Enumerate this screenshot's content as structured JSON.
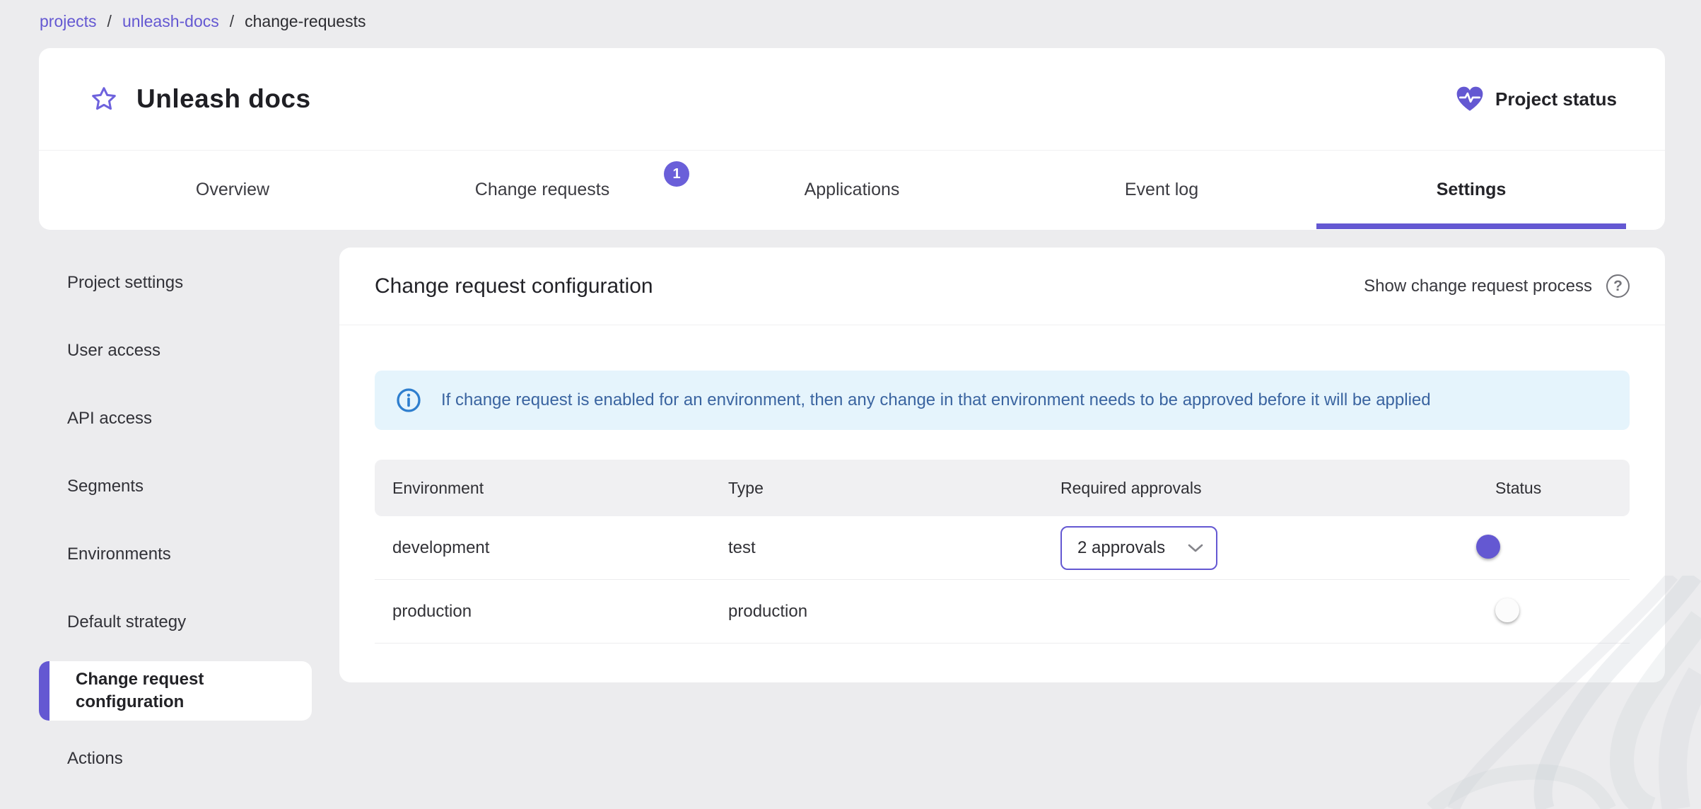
{
  "theme": {
    "primary": "#6458d2",
    "primary_light": "#aba3e8",
    "page_bg": "#ececee",
    "card_bg": "#ffffff",
    "alert_bg": "#e5f4fc",
    "alert_text": "#3a64a0",
    "alert_icon": "#2e7ece",
    "toggle_off": "#a5a5a5",
    "table_header_bg": "#f0f0f2"
  },
  "breadcrumb": {
    "separator": "/",
    "items": [
      {
        "label": "projects"
      },
      {
        "label": "unleash-docs"
      },
      {
        "label": "change-requests"
      }
    ]
  },
  "project_header": {
    "title": "Unleash docs",
    "status_label": "Project status"
  },
  "tabs": [
    {
      "label": "Overview"
    },
    {
      "label": "Change requests",
      "badge": "1"
    },
    {
      "label": "Applications"
    },
    {
      "label": "Event log"
    },
    {
      "label": "Settings",
      "active": true
    }
  ],
  "sidebar": {
    "items": [
      {
        "label": "Project settings"
      },
      {
        "label": "User access"
      },
      {
        "label": "API access"
      },
      {
        "label": "Segments"
      },
      {
        "label": "Environments"
      },
      {
        "label": "Default strategy"
      },
      {
        "label": "Change request configuration",
        "active": true
      },
      {
        "label": "Actions"
      }
    ]
  },
  "main": {
    "title": "Change request configuration",
    "help_link": "Show change request process",
    "help_glyph": "?",
    "alert": "If change request is enabled for an environment, then any change in that environment needs to be approved before it will be applied",
    "table": {
      "columns": [
        "Environment",
        "Type",
        "Required approvals",
        "Status"
      ],
      "rows": [
        {
          "environment": "development",
          "type": "test",
          "required_approvals": "2 approvals",
          "enabled": true
        },
        {
          "environment": "production",
          "type": "production",
          "required_approvals": "",
          "enabled": false
        }
      ]
    }
  }
}
